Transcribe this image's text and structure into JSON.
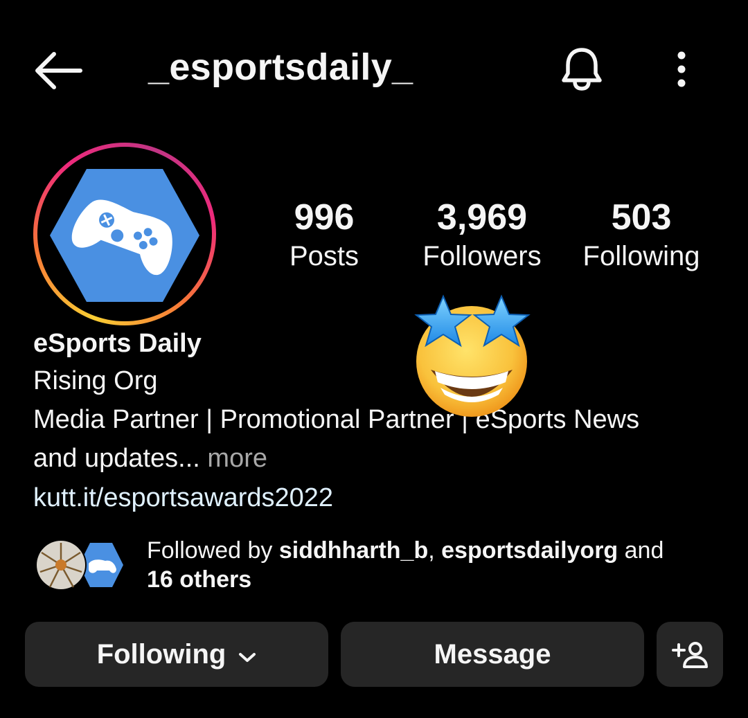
{
  "header": {
    "username": "_esportsdaily_",
    "back_icon": "arrow-left-icon",
    "bell_icon": "bell-icon",
    "more_icon": "more-vertical-icon"
  },
  "profile": {
    "avatar_icon": "gamepad-icon",
    "stats": {
      "posts_count": "996",
      "posts_label": "Posts",
      "followers_count": "3,969",
      "followers_label": "Followers",
      "following_count": "503",
      "following_label": "Following"
    },
    "display_name": "eSports Daily",
    "category": "Rising Org",
    "bio_line1": "Media Partner | Promotional Partner | eSports News",
    "bio_line2": "and updates...",
    "more_label": "more",
    "link": "kutt.it/esportsawards2022",
    "sticker": "star-struck-emoji"
  },
  "followed_by": {
    "prefix": "Followed by ",
    "user1": "siddhharth_b",
    "separator": ", ",
    "user2": "esportsdailyorg",
    "conjunction": " and",
    "others": "16 others"
  },
  "actions": {
    "following_label": "Following",
    "message_label": "Message",
    "add_user_icon": "add-user-icon"
  },
  "colors": {
    "background": "#000000",
    "text": "#f5f5f5",
    "button_bg": "#262626",
    "link": "#e0f1ff",
    "muted": "#a8a8a8",
    "avatar_blue": "#4a90e2"
  }
}
